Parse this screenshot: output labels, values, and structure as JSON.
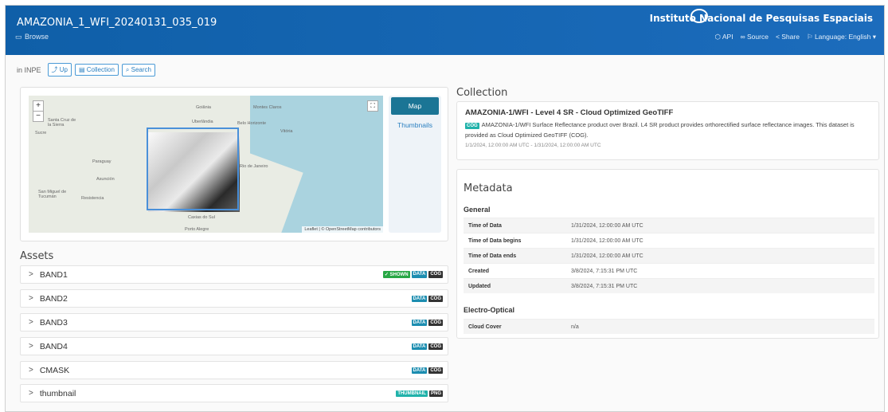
{
  "header": {
    "title": "AMAZONIA_1_WFI_20240131_035_019",
    "browse_label": "Browse",
    "org_name": "Instituto Nacional de Pesquisas Espaciais",
    "links": {
      "api": "API",
      "source": "Source",
      "share": "Share",
      "language": "Language: English"
    }
  },
  "breadcrumb": {
    "in_label": "in INPE",
    "up": "Up",
    "collection": "Collection",
    "search": "Search"
  },
  "map": {
    "zoom_in": "+",
    "zoom_out": "−",
    "attribution": "Leaflet | © OpenStreetMap contributors",
    "places": {
      "goiania": "Goiânia",
      "montes_claros": "Montes Claros",
      "uberlandia": "Uberlândia",
      "belo_horizonte": "Belo Horizonte",
      "vitoria": "Vitória",
      "santa_cruz": "Santa Cruz de la Sierra",
      "sucre": "Sucre",
      "paraguay": "Paraguay",
      "asuncion": "Asunción",
      "san_miguel": "San Miguel de Tucumán",
      "resistencia": "Resistencia",
      "rio": "Rio de Janeiro",
      "porto_alegre": "Porto Alegre",
      "caxias": "Caxias do Sul"
    }
  },
  "view_tabs": [
    "Map",
    "Thumbnails"
  ],
  "assets": {
    "heading": "Assets",
    "items": [
      {
        "name": "BAND1",
        "badges": [
          "✓ SHOWN",
          "DATA",
          "COG"
        ]
      },
      {
        "name": "BAND2",
        "badges": [
          "DATA",
          "COG"
        ]
      },
      {
        "name": "BAND3",
        "badges": [
          "DATA",
          "COG"
        ]
      },
      {
        "name": "BAND4",
        "badges": [
          "DATA",
          "COG"
        ]
      },
      {
        "name": "CMASK",
        "badges": [
          "DATA",
          "COG"
        ]
      },
      {
        "name": "thumbnail",
        "badges": [
          "THUMBNAIL",
          "PNG"
        ]
      }
    ]
  },
  "collection": {
    "heading": "Collection",
    "title": "AMAZONIA-1/WFI - Level 4 SR - Cloud Optimized GeoTIFF",
    "badge": "COG",
    "description": "AMAZONIA-1/WFI Surface Reflectance product over Brazil. L4 SR product provides orthorectified surface reflectance images. This dataset is provided as Cloud Optimized GeoTIFF (COG).",
    "range": "1/1/2024, 12:00:00 AM UTC - 1/31/2024, 12:00:00 AM UTC"
  },
  "metadata": {
    "heading": "Metadata",
    "general_heading": "General",
    "general": [
      {
        "k": "Time of Data",
        "v": "1/31/2024, 12:00:00 AM UTC"
      },
      {
        "k": "Time of Data begins",
        "v": "1/31/2024, 12:00:00 AM UTC"
      },
      {
        "k": "Time of Data ends",
        "v": "1/31/2024, 12:00:00 AM UTC"
      },
      {
        "k": "Created",
        "v": "3/8/2024, 7:15:31 PM UTC"
      },
      {
        "k": "Updated",
        "v": "3/8/2024, 7:15:31 PM UTC"
      }
    ],
    "eo_heading": "Electro-Optical",
    "eo": [
      {
        "k": "Cloud Cover",
        "v": "n/a"
      }
    ]
  }
}
